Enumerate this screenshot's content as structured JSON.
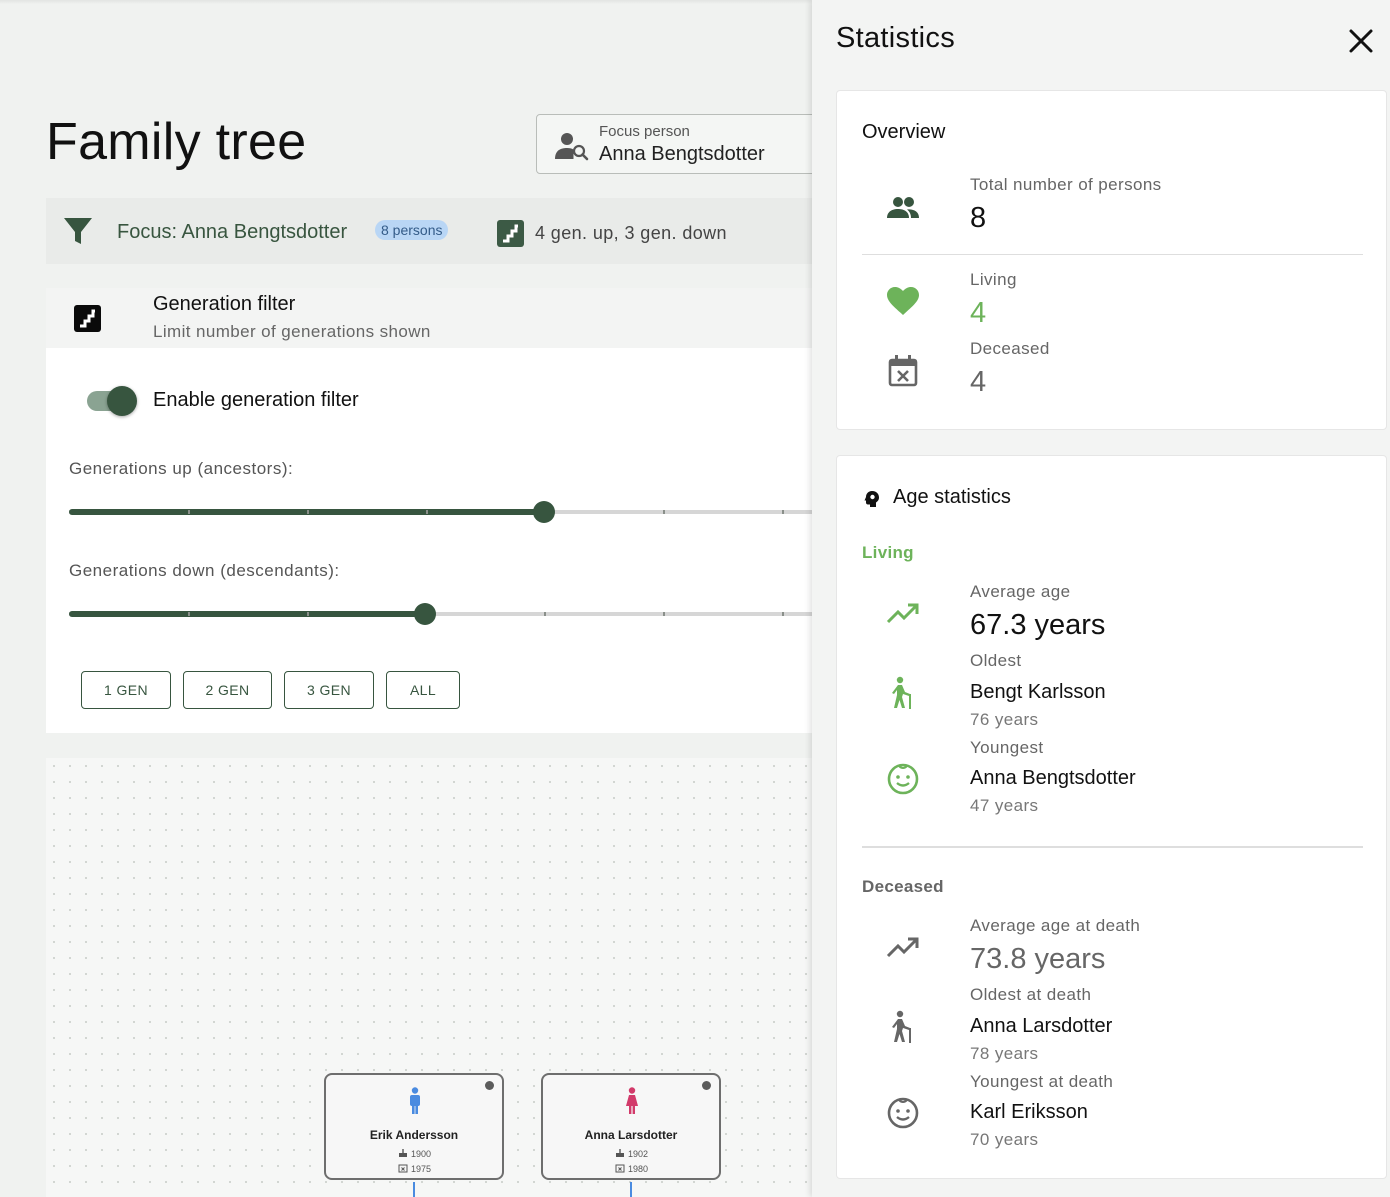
{
  "page": {
    "title": "Family tree"
  },
  "focus_field": {
    "label": "Focus person",
    "value": "Anna Bengtsdotter"
  },
  "filter_bar": {
    "focus_text": "Focus: Anna Bengtsdotter",
    "persons_badge": "8 persons",
    "generations_text": "4 gen. up, 3 gen. down"
  },
  "generation_filter": {
    "title": "Generation filter",
    "subtitle": "Limit number of generations shown",
    "toggle_label": "Enable generation filter",
    "toggle_on": true,
    "up_label": "Generations up (ancestors):",
    "up_value": 4,
    "down_label": "Generations down (descendants):",
    "down_value": 3,
    "buttons": [
      "1 GEN",
      "2 GEN",
      "3 GEN",
      "ALL"
    ]
  },
  "tree": {
    "persons": [
      {
        "name": "Erik Andersson",
        "born": "1900",
        "died": "1975",
        "gender": "male",
        "color": "#4a8be0"
      },
      {
        "name": "Anna Larsdotter",
        "born": "1902",
        "died": "1980",
        "gender": "female",
        "color": "#d23a6a"
      }
    ]
  },
  "statistics": {
    "title": "Statistics",
    "overview": {
      "title": "Overview",
      "total_label": "Total number of persons",
      "total_value": "8",
      "living_label": "Living",
      "living_value": "4",
      "deceased_label": "Deceased",
      "deceased_value": "4"
    },
    "age": {
      "title": "Age statistics",
      "living": {
        "heading": "Living",
        "avg_label": "Average age",
        "avg_value": "67.3 years",
        "oldest_label": "Oldest",
        "oldest_name": "Bengt Karlsson",
        "oldest_age": "76 years",
        "youngest_label": "Youngest",
        "youngest_name": "Anna Bengtsdotter",
        "youngest_age": "47 years"
      },
      "deceased": {
        "heading": "Deceased",
        "avg_label": "Average age at death",
        "avg_value": "73.8 years",
        "oldest_label": "Oldest at death",
        "oldest_name": "Anna Larsdotter",
        "oldest_age": "78 years",
        "youngest_label": "Youngest at death",
        "youngest_name": "Karl Eriksson",
        "youngest_age": "70 years"
      }
    }
  },
  "colors": {
    "primary": "#37553f",
    "living_green": "#6db35a",
    "neutral_grey": "#666666"
  }
}
